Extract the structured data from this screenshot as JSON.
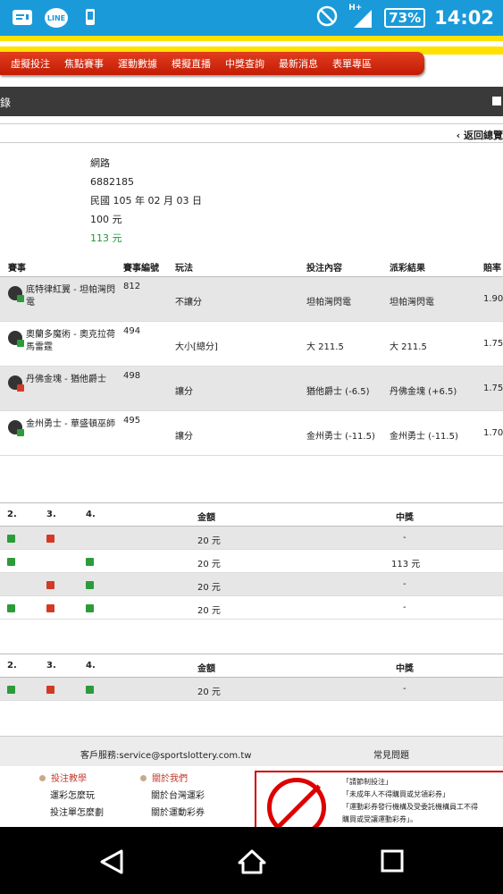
{
  "status_bar": {
    "network": "H+",
    "battery": "73%",
    "time": "14:02"
  },
  "nav": {
    "items": [
      "虛擬投注",
      "焦點賽事",
      "運動數據",
      "模擬直播",
      "中獎查詢",
      "最新消息",
      "表單專區"
    ]
  },
  "title_bar": {
    "title": "錄"
  },
  "back_link": "‹ 返回總覽",
  "ticket": {
    "channel": "網路",
    "number": "6882185",
    "date": "民國 105 年 02 月 03 日",
    "stake": "100 元",
    "payout": "113 元"
  },
  "bets": {
    "headers": [
      "賽事",
      "賽事編號",
      "玩法",
      "投注內容",
      "派彩結果",
      "賠率"
    ],
    "rows": [
      {
        "match": "底特律紅翼 - 坦帕灣閃電",
        "no": "812",
        "play": "不讓分",
        "content": "坦帕灣閃電",
        "result": "坦帕灣閃電",
        "odds": "1.90"
      },
      {
        "match": "奧蘭多魔術 - 奧克拉荷馬雷霆",
        "no": "494",
        "play": "大小[總分]",
        "content": "大 211.5",
        "result": "大 211.5",
        "odds": "1.75"
      },
      {
        "match": "丹佛金塊 - 猶他爵士",
        "no": "498",
        "play": "讓分",
        "content": "猶他爵士 (-6.5)",
        "result": "丹佛金塊 (+6.5)",
        "odds": "1.75"
      },
      {
        "match": "金州勇士 - 華盛頓巫師",
        "no": "495",
        "play": "讓分",
        "content": "金州勇士 (-11.5)",
        "result": "金州勇士 (-11.5)",
        "odds": "1.70"
      }
    ]
  },
  "parlay1": {
    "headers": [
      "2.",
      "3.",
      "4.",
      "金額",
      "中獎"
    ],
    "rows": [
      {
        "marks": [
          "plus",
          "minus",
          ""
        ],
        "amount": "20 元",
        "win": "-"
      },
      {
        "marks": [
          "plus",
          "",
          "plus"
        ],
        "amount": "20 元",
        "win": "113 元"
      },
      {
        "marks": [
          "",
          "minus",
          "plus"
        ],
        "amount": "20 元",
        "win": "-"
      },
      {
        "marks": [
          "plus",
          "minus",
          "plus"
        ],
        "amount": "20 元",
        "win": "-"
      }
    ]
  },
  "parlay2": {
    "headers": [
      "2.",
      "3.",
      "4.",
      "金額",
      "中獎"
    ],
    "rows": [
      {
        "marks": [
          "plus",
          "minus",
          "plus"
        ],
        "amount": "20 元",
        "win": "-"
      }
    ]
  },
  "footer": {
    "service": "客戶服務:service@sportslottery.com.tw",
    "faq": "常見問題",
    "col1": {
      "head": "投注教學",
      "links": [
        "運彩怎麼玩",
        "投注單怎麼劃"
      ]
    },
    "col2": {
      "head": "關於我們",
      "links": [
        "關於台灣運彩",
        "關於運動彩券"
      ]
    },
    "warnings": [
      "「請節制投注」",
      "「未成年人不得購買或兌領彩券」",
      "「運動彩券發行機構及受委託機構員工不得",
      "購買或受讓運動彩券」。"
    ]
  }
}
